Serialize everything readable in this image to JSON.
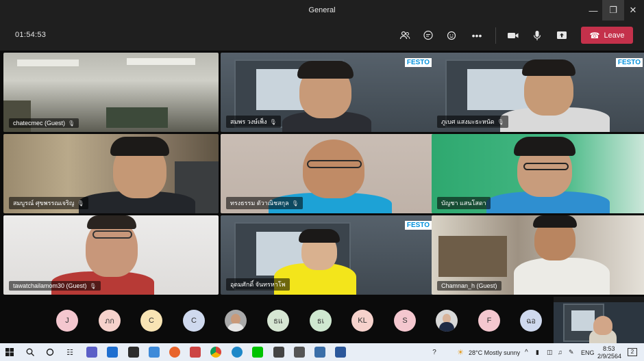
{
  "window": {
    "title": "General"
  },
  "toolbar": {
    "timer": "01:54:53",
    "leave_label": "Leave"
  },
  "tiles": [
    {
      "name": "chatecmec (Guest)"
    },
    {
      "name": "สมพร วงษ์เพ็ง"
    },
    {
      "name": "ภูเบศ แสงมะธะหนัด"
    },
    {
      "name": "สมบูรณ์ ศุขพรรณเจริญ"
    },
    {
      "name": "ทรงธรรม ตัวาณิชสกุล"
    },
    {
      "name": "บัญชา แสนโสดา"
    },
    {
      "name": "tawatchailamom30 (Guest)"
    },
    {
      "name": "อุดมศักดิ์ จันทรหาโพ"
    },
    {
      "name": "Chamnan_h (Guest)"
    }
  ],
  "festo_label": "FESTO",
  "roster": [
    {
      "initials": "J",
      "color": "#f4c7cf"
    },
    {
      "initials": "ภก",
      "color": "#f6d2cc"
    },
    {
      "initials": "C",
      "color": "#f8e4b4"
    },
    {
      "initials": "C",
      "color": "#cfd9ee"
    },
    {
      "initials": "",
      "color": "#a9a9a9"
    },
    {
      "initials": "ธแ",
      "color": "#d6e6d3"
    },
    {
      "initials": "ธเ",
      "color": "#cfe8d0"
    },
    {
      "initials": "KL",
      "color": "#f6d2cc"
    },
    {
      "initials": "S",
      "color": "#f4c7cf"
    },
    {
      "initials": "",
      "color": "#cccccc"
    },
    {
      "initials": "F",
      "color": "#f4c7cf"
    },
    {
      "initials": "ฉอ",
      "color": "#cfd9ee"
    }
  ],
  "taskbar": {
    "weather": "28°C  Mostly sunny",
    "lang": "ENG",
    "time": "8:53",
    "date": "2/9/2564",
    "notif_count": "2"
  }
}
